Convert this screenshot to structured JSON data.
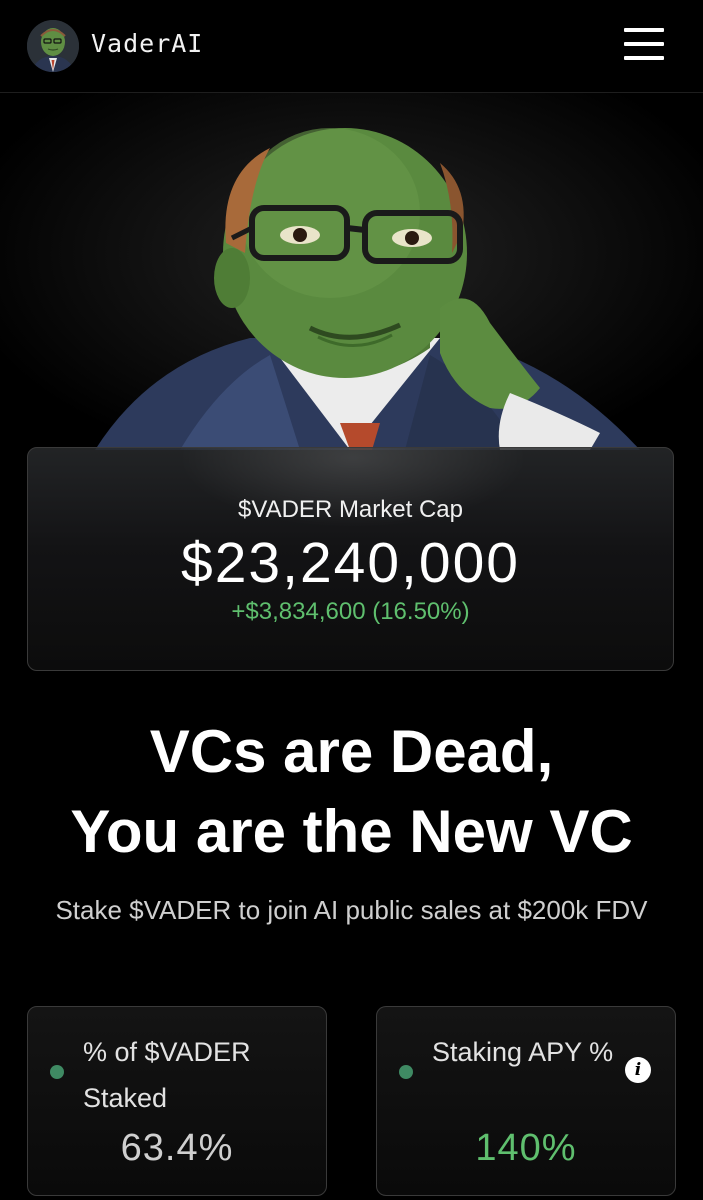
{
  "header": {
    "brand": "VaderAI",
    "menu_icon": "hamburger-menu-icon"
  },
  "market_cap": {
    "label": "$VADER Market Cap",
    "value": "$23,240,000",
    "change": "+$3,834,600 (16.50%)"
  },
  "headline": {
    "line1": "VCs are Dead,",
    "line2": "You are the New VC"
  },
  "subheadline": "Stake $VADER to join AI public sales at $200k FDV",
  "stats": [
    {
      "label": "% of $VADER Staked",
      "value": "63.4%",
      "value_color": "#cfcfcf"
    },
    {
      "label": "Staking APY %",
      "value": "140%",
      "value_color": "#5fbf6e",
      "info_icon": "i"
    }
  ],
  "colors": {
    "accent_green": "#5fbf6e",
    "status_dot": "#3f8a63",
    "background": "#000000"
  }
}
